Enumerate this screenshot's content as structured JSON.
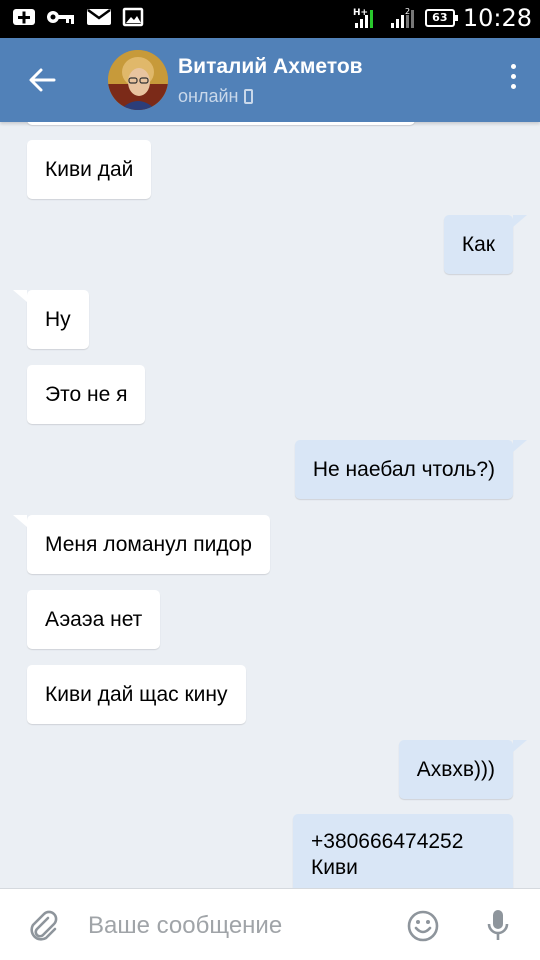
{
  "status_bar": {
    "time": "10:28",
    "battery": "63",
    "network_label": "H+"
  },
  "header": {
    "contact_name": "Виталий Ахметов",
    "contact_status": "онлайн"
  },
  "messages": [
    {
      "direction": "in",
      "text": "Киви дай"
    },
    {
      "direction": "out",
      "text": "Как"
    },
    {
      "direction": "in",
      "text": "Ну"
    },
    {
      "direction": "in",
      "text": "Это не я"
    },
    {
      "direction": "out",
      "text": "Не наебал чтоль?)"
    },
    {
      "direction": "in",
      "text": "Меня ломанул пидор"
    },
    {
      "direction": "in",
      "text": "Аэаэа нет"
    },
    {
      "direction": "in",
      "text": "Киви дай щас кину"
    },
    {
      "direction": "out",
      "text": "Ахвхв)))"
    },
    {
      "direction": "out",
      "text": "+380666474252",
      "text2": "Киви"
    }
  ],
  "composer": {
    "placeholder": "Ваше сообщение"
  },
  "colors": {
    "toolbar": "#5181b8",
    "background": "#ebeff4",
    "incoming_bubble": "#ffffff",
    "outgoing_bubble": "#d9e6f6"
  },
  "icons": {
    "back": "arrow-left-icon",
    "menu": "more-vertical-icon",
    "attach": "paperclip-icon",
    "emoji": "smiley-icon",
    "mic": "microphone-icon"
  }
}
